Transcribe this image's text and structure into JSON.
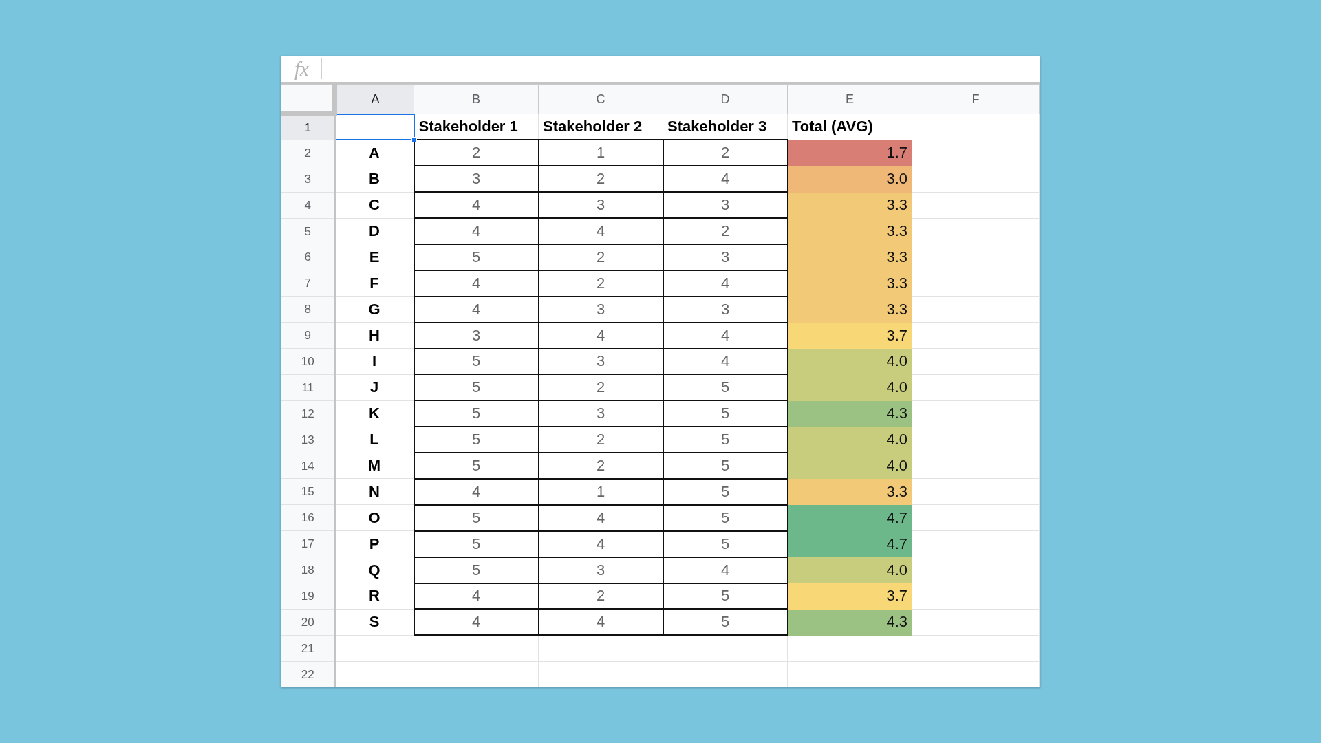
{
  "formula_bar": {
    "label": "fx"
  },
  "columns": [
    {
      "label": "A",
      "selected": true
    },
    {
      "label": "B",
      "selected": false
    },
    {
      "label": "C",
      "selected": false
    },
    {
      "label": "D",
      "selected": false
    },
    {
      "label": "E",
      "selected": false
    },
    {
      "label": "F",
      "selected": false
    }
  ],
  "row_numbers": [
    {
      "label": "1",
      "selected": true
    },
    {
      "label": "2",
      "selected": false
    },
    {
      "label": "3",
      "selected": false
    },
    {
      "label": "4",
      "selected": false
    },
    {
      "label": "5",
      "selected": false
    },
    {
      "label": "6",
      "selected": false
    },
    {
      "label": "7",
      "selected": false
    },
    {
      "label": "8",
      "selected": false
    },
    {
      "label": "9",
      "selected": false
    },
    {
      "label": "10",
      "selected": false
    },
    {
      "label": "11",
      "selected": false
    },
    {
      "label": "12",
      "selected": false
    },
    {
      "label": "13",
      "selected": false
    },
    {
      "label": "14",
      "selected": false
    },
    {
      "label": "15",
      "selected": false
    },
    {
      "label": "16",
      "selected": false
    },
    {
      "label": "17",
      "selected": false
    },
    {
      "label": "18",
      "selected": false
    },
    {
      "label": "19",
      "selected": false
    },
    {
      "label": "20",
      "selected": false
    },
    {
      "label": "21",
      "selected": false
    },
    {
      "label": "22",
      "selected": false
    }
  ],
  "headers": [
    "Stakeholder 1",
    "Stakeholder 2",
    "Stakeholder 3",
    "Total (AVG)"
  ],
  "rows": [
    {
      "label": "A",
      "scores": [
        "2",
        "1",
        "2"
      ],
      "total": "1.7",
      "color": "#d97e74"
    },
    {
      "label": "B",
      "scores": [
        "3",
        "2",
        "4"
      ],
      "total": "3.0",
      "color": "#efb877"
    },
    {
      "label": "C",
      "scores": [
        "4",
        "3",
        "3"
      ],
      "total": "3.3",
      "color": "#f2c977"
    },
    {
      "label": "D",
      "scores": [
        "4",
        "4",
        "2"
      ],
      "total": "3.3",
      "color": "#f2c977"
    },
    {
      "label": "E",
      "scores": [
        "5",
        "2",
        "3"
      ],
      "total": "3.3",
      "color": "#f2c977"
    },
    {
      "label": "F",
      "scores": [
        "4",
        "2",
        "4"
      ],
      "total": "3.3",
      "color": "#f2c977"
    },
    {
      "label": "G",
      "scores": [
        "4",
        "3",
        "3"
      ],
      "total": "3.3",
      "color": "#f2c977"
    },
    {
      "label": "H",
      "scores": [
        "3",
        "4",
        "4"
      ],
      "total": "3.7",
      "color": "#f8d876"
    },
    {
      "label": "I",
      "scores": [
        "5",
        "3",
        "4"
      ],
      "total": "4.0",
      "color": "#c8cd7d"
    },
    {
      "label": "J",
      "scores": [
        "5",
        "2",
        "5"
      ],
      "total": "4.0",
      "color": "#c8cd7d"
    },
    {
      "label": "K",
      "scores": [
        "5",
        "3",
        "5"
      ],
      "total": "4.3",
      "color": "#9cc283"
    },
    {
      "label": "L",
      "scores": [
        "5",
        "2",
        "5"
      ],
      "total": "4.0",
      "color": "#c8cd7d"
    },
    {
      "label": "M",
      "scores": [
        "5",
        "2",
        "5"
      ],
      "total": "4.0",
      "color": "#c8cd7d"
    },
    {
      "label": "N",
      "scores": [
        "4",
        "1",
        "5"
      ],
      "total": "3.3",
      "color": "#f2c977"
    },
    {
      "label": "O",
      "scores": [
        "5",
        "4",
        "5"
      ],
      "total": "4.7",
      "color": "#6db88a"
    },
    {
      "label": "P",
      "scores": [
        "5",
        "4",
        "5"
      ],
      "total": "4.7",
      "color": "#6db88a"
    },
    {
      "label": "Q",
      "scores": [
        "5",
        "3",
        "4"
      ],
      "total": "4.0",
      "color": "#c8cd7d"
    },
    {
      "label": "R",
      "scores": [
        "4",
        "2",
        "5"
      ],
      "total": "3.7",
      "color": "#f8d876"
    },
    {
      "label": "S",
      "scores": [
        "4",
        "4",
        "5"
      ],
      "total": "4.3",
      "color": "#9cc283"
    }
  ]
}
